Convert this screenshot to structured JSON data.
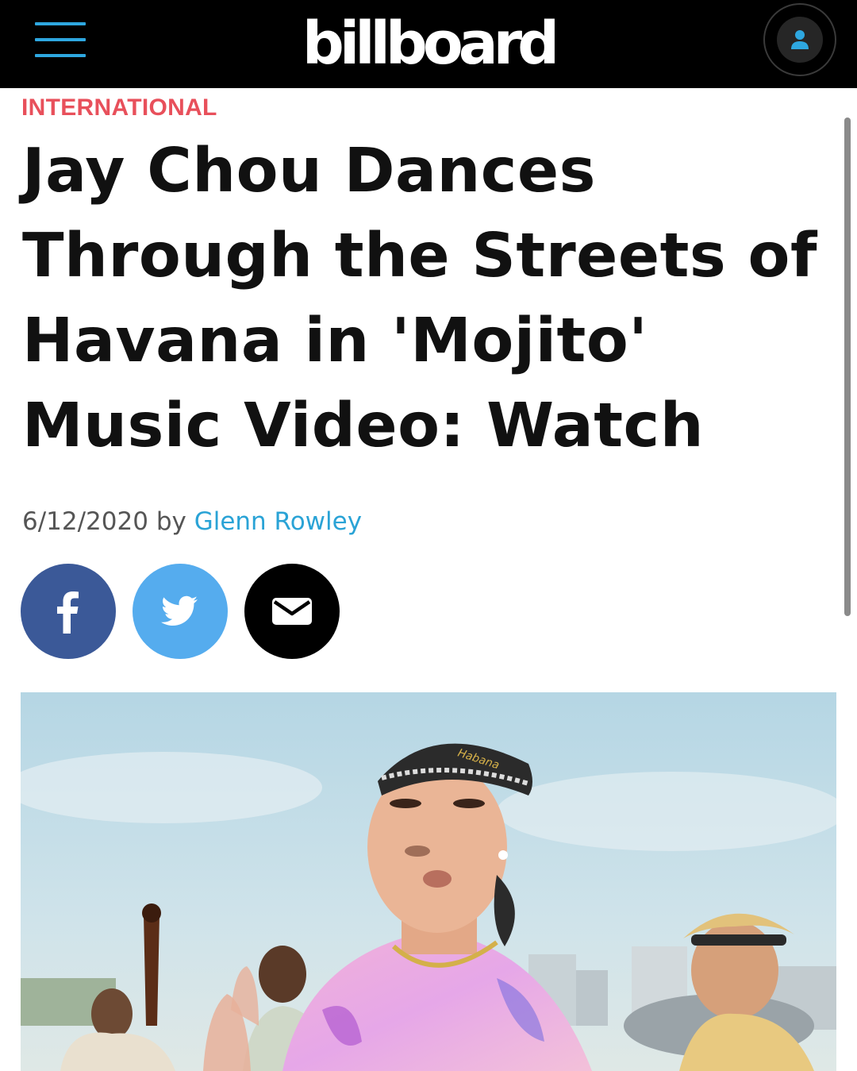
{
  "header": {
    "logo": "billboard",
    "menu_icon": "hamburger-menu-icon",
    "account_icon": "user-icon",
    "colors": {
      "bar": "#000000",
      "menu": "#2ea7e0",
      "account": "#2ea7e0"
    }
  },
  "article": {
    "category": "INTERNATIONAL",
    "title_lines": [
      "Jay Chou Dances",
      "Through the Streets of",
      "Havana in 'Mojito'",
      "Music Video: Watch"
    ],
    "date": "6/12/2020",
    "by": "by",
    "author": "Glenn Rowley",
    "colors": {
      "category": "#e8505b",
      "author": "#2aa3d6"
    }
  },
  "share": [
    {
      "icon": "facebook-icon",
      "color": "#3b5998"
    },
    {
      "icon": "twitter-icon",
      "color": "#55acee"
    },
    {
      "icon": "email-icon",
      "color": "#000000"
    }
  ],
  "hero_image": {
    "cap_text": "Habana"
  }
}
